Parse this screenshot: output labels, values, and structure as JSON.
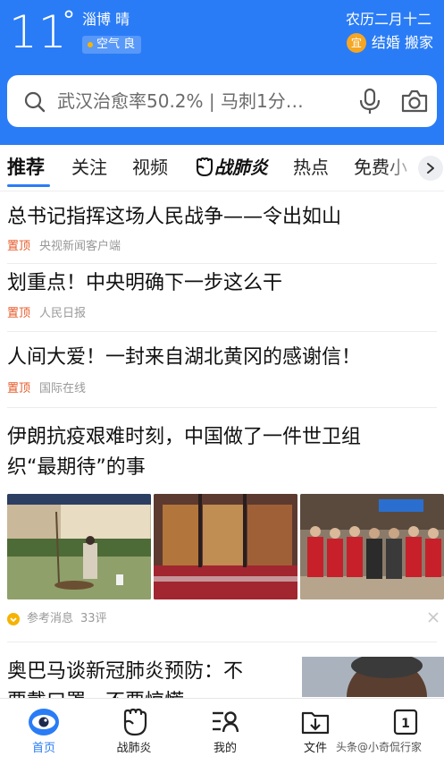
{
  "weather": {
    "temperature": "11",
    "degree_symbol": "°",
    "city_condition": "淄博 晴",
    "air_quality": "空气 良",
    "lunar_date": "农历二月十二",
    "yi_badge": "宜",
    "yi_text": "结婚 搬家"
  },
  "search": {
    "placeholder": "武汉治愈率50.2% | 马刺1分…",
    "icons": [
      "search-icon",
      "microphone-icon",
      "camera-icon"
    ]
  },
  "tabs": {
    "items": [
      "推荐",
      "关注",
      "视频",
      "战肺炎",
      "热点",
      "免费小"
    ],
    "active": "推荐"
  },
  "feed": [
    {
      "title": "总书记指挥这场人民战争——令出如山",
      "pin": "置顶",
      "source": "央视新闻客户端"
    },
    {
      "title": "划重点！中央明确下一步这么干",
      "pin": "置顶",
      "source": "人民日报"
    },
    {
      "title": "人间大爱！一封来自湖北黄冈的感谢信！",
      "pin": "置顶",
      "source": "国际在线"
    },
    {
      "title_line1": "伊朗抗疫艰难时刻，中国做了一件世卫组",
      "title_line2": "织“最期待”的事",
      "source": "参考消息",
      "comments": "33评"
    },
    {
      "title_line1": "奥巴马谈新冠肺炎预防：不",
      "title_line2": "要戴口罩，不要惊慌"
    }
  ],
  "bottom_nav": [
    {
      "label": "首页",
      "icon": "eye-icon",
      "active": true
    },
    {
      "label": "战肺炎",
      "icon": "fist-icon",
      "active": false
    },
    {
      "label": "我的",
      "icon": "profile-icon",
      "active": false
    },
    {
      "label": "文件",
      "icon": "folder-download-icon",
      "active": false
    },
    {
      "label": "1",
      "icon": "tabs-count-icon",
      "active": false
    }
  ],
  "watermark": "头条@小奇侃行家",
  "colors": {
    "brand_blue": "#2a7cf6",
    "pin_orange": "#e65a2a",
    "yi_badge": "#f5a623"
  }
}
